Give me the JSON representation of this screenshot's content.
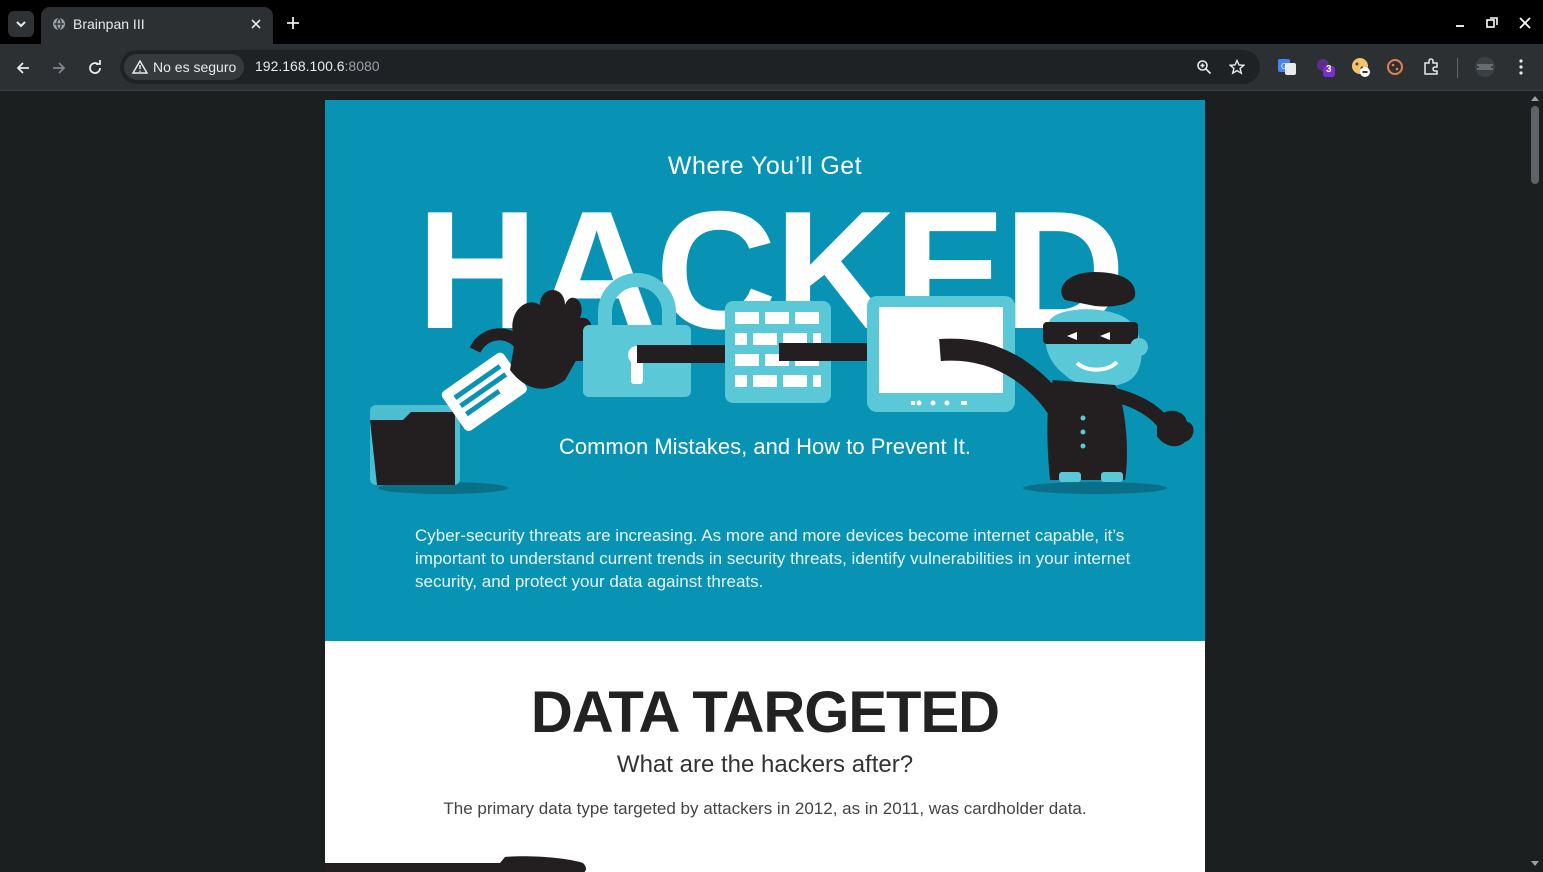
{
  "browser": {
    "tab_title": "Brainpan III",
    "security_label": "No es seguro",
    "url_host": "192.168.100.6",
    "url_port": ":8080",
    "extension_badge": "3"
  },
  "page": {
    "hero": {
      "kicker": "Where You’ll Get",
      "headline": "HACKED",
      "subtitle": "Common Mistakes, and How to Prevent It.",
      "intro": "Cyber-security threats are increasing. As more and more devices become internet capable, it’s important to understand current trends in security threats, identify vulnerabilities in your internet security, and protect your data against threats."
    },
    "section": {
      "title": "DATA TARGETED",
      "subtitle": "What are the hackers after?",
      "text": "The primary data type targeted by attackers in 2012, as in 2011, was cardholder data."
    }
  },
  "colors": {
    "hero_bg": "#0893b4",
    "accent_light": "#5bc8d8",
    "ink": "#231f20"
  }
}
